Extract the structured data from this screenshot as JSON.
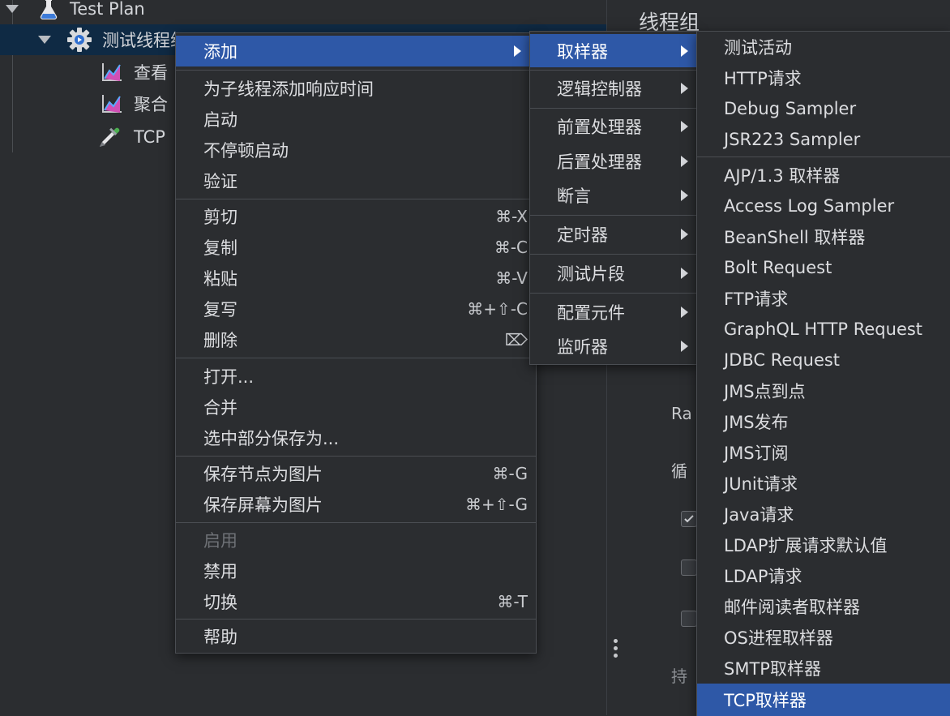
{
  "tree": {
    "nodes": [
      {
        "label": "Test Plan"
      },
      {
        "label": "测试线程组"
      },
      {
        "label": "查看"
      },
      {
        "label": "聚合"
      },
      {
        "label": "TCP"
      }
    ]
  },
  "right_panel": {
    "title": "线程组",
    "partial_labels": [
      "Ra",
      "循",
      "持"
    ]
  },
  "context_menu": {
    "items": [
      {
        "label": "添加"
      },
      {
        "label": "为子线程添加响应时间"
      },
      {
        "label": "启动"
      },
      {
        "label": "不停顿启动"
      },
      {
        "label": "验证"
      },
      {
        "label": "剪切",
        "shortcut": "⌘-X"
      },
      {
        "label": "复制",
        "shortcut": "⌘-C"
      },
      {
        "label": "粘贴",
        "shortcut": "⌘-V"
      },
      {
        "label": "复写",
        "shortcut": "⌘+⇧-C"
      },
      {
        "label": "删除",
        "shortcut": "⌦"
      },
      {
        "label": "打开..."
      },
      {
        "label": "合并"
      },
      {
        "label": "选中部分保存为..."
      },
      {
        "label": "保存节点为图片",
        "shortcut": "⌘-G"
      },
      {
        "label": "保存屏幕为图片",
        "shortcut": "⌘+⇧-G"
      },
      {
        "label": "启用"
      },
      {
        "label": "禁用"
      },
      {
        "label": "切换",
        "shortcut": "⌘-T"
      },
      {
        "label": "帮助"
      }
    ]
  },
  "add_menu": {
    "items": [
      {
        "label": "取样器"
      },
      {
        "label": "逻辑控制器"
      },
      {
        "label": "前置处理器"
      },
      {
        "label": "后置处理器"
      },
      {
        "label": "断言"
      },
      {
        "label": "定时器"
      },
      {
        "label": "测试片段"
      },
      {
        "label": "配置元件"
      },
      {
        "label": "监听器"
      }
    ]
  },
  "sampler_menu": {
    "items": [
      {
        "label": "测试活动"
      },
      {
        "label": "HTTP请求"
      },
      {
        "label": "Debug Sampler"
      },
      {
        "label": "JSR223 Sampler"
      },
      {
        "label": "AJP/1.3 取样器"
      },
      {
        "label": "Access Log Sampler"
      },
      {
        "label": "BeanShell 取样器"
      },
      {
        "label": "Bolt Request"
      },
      {
        "label": "FTP请求"
      },
      {
        "label": "GraphQL HTTP Request"
      },
      {
        "label": "JDBC Request"
      },
      {
        "label": "JMS点到点"
      },
      {
        "label": "JMS发布"
      },
      {
        "label": "JMS订阅"
      },
      {
        "label": "JUnit请求"
      },
      {
        "label": "Java请求"
      },
      {
        "label": "LDAP扩展请求默认值"
      },
      {
        "label": "LDAP请求"
      },
      {
        "label": "邮件阅读者取样器"
      },
      {
        "label": "OS进程取样器"
      },
      {
        "label": "SMTP取样器"
      },
      {
        "label": "TCP取样器"
      }
    ]
  },
  "colors": {
    "background": "#2b2d30",
    "selection": "#2e58a7",
    "tree_selection": "#0f2a44",
    "text": "#dcdde0",
    "disabled_text": "#6e7176"
  }
}
